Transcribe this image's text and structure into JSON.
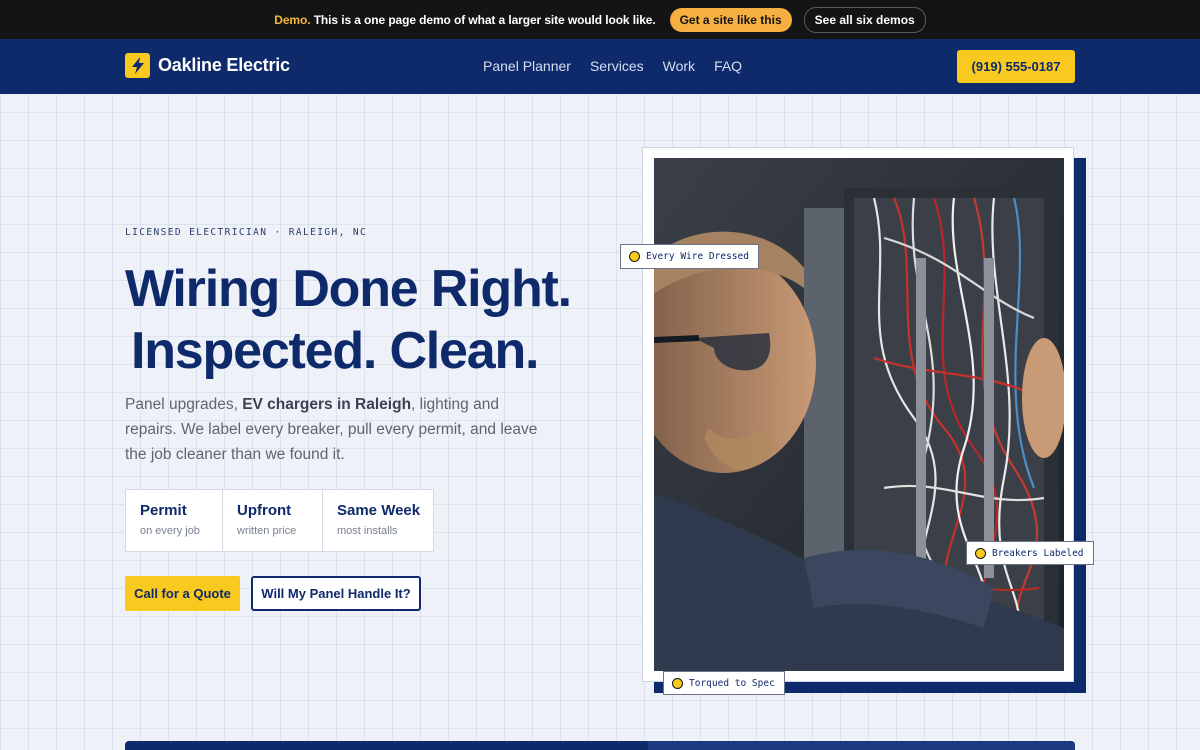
{
  "demo_bar": {
    "lead": "Demo.",
    "text": "This is a one page demo of what a larger site would look like.",
    "primary_btn": "Get a site like this",
    "secondary_btn": "See all six demos"
  },
  "nav": {
    "brand": "Oakline Electric",
    "links": [
      "Panel Planner",
      "Services",
      "Work",
      "FAQ"
    ],
    "phone": "(919) 555-0187"
  },
  "hero": {
    "eyebrow": "LICENSED ELECTRICIAN · RALEIGH, NC",
    "headline_line1": "Wiring Done Right.",
    "headline_highlight": "Inspected.",
    "headline_end": "Clean.",
    "lede_1": "Panel upgrades, ",
    "lede_bold": "EV chargers in Raleigh",
    "lede_2": ", lighting and repairs. We label every breaker, pull every permit, and leave the job cleaner than we found it.",
    "stats": [
      {
        "title": "Permit",
        "sub": "on every job"
      },
      {
        "title": "Upfront",
        "sub": "written price"
      },
      {
        "title": "Same Week",
        "sub": "most installs"
      }
    ],
    "cta_primary": "Call for a Quote",
    "cta_secondary": "Will My Panel Handle It?"
  },
  "photo_tags": [
    "Every Wire Dressed",
    "Breakers Labeled",
    "Torqued to Spec"
  ],
  "colors": {
    "navy": "#0e2a6b",
    "yellow": "#f8c91e",
    "demo_accent": "#f6b042",
    "background": "#eef2f8"
  },
  "icons": {
    "logo": "lightning-bolt-icon",
    "tag_marker": "dot-icon"
  }
}
